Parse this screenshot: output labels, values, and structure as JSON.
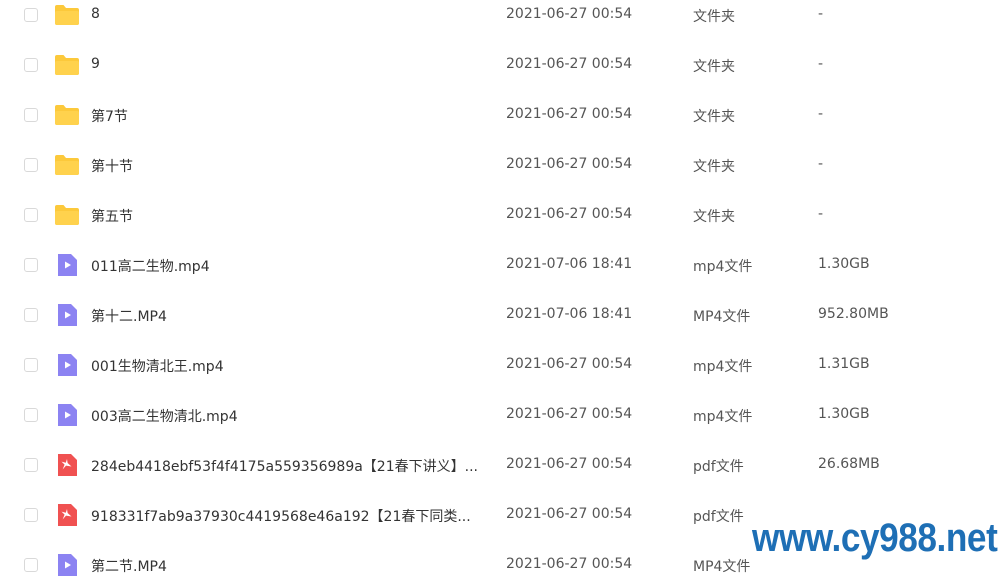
{
  "files": [
    {
      "name": "8",
      "date": "2021-06-27 00:54",
      "type": "文件夹",
      "size": "-",
      "icon": "folder-icon"
    },
    {
      "name": "9",
      "date": "2021-06-27 00:54",
      "type": "文件夹",
      "size": "-",
      "icon": "folder-icon"
    },
    {
      "name": "第7节",
      "date": "2021-06-27 00:54",
      "type": "文件夹",
      "size": "-",
      "icon": "folder-icon"
    },
    {
      "name": "第十节",
      "date": "2021-06-27 00:54",
      "type": "文件夹",
      "size": "-",
      "icon": "folder-icon"
    },
    {
      "name": "第五节",
      "date": "2021-06-27 00:54",
      "type": "文件夹",
      "size": "-",
      "icon": "folder-icon"
    },
    {
      "name": "011高二生物.mp4",
      "date": "2021-07-06 18:41",
      "type": "mp4文件",
      "size": "1.30GB",
      "icon": "video-icon"
    },
    {
      "name": "第十二.MP4",
      "date": "2021-07-06 18:41",
      "type": "MP4文件",
      "size": "952.80MB",
      "icon": "video-icon"
    },
    {
      "name": "001生物清北王.mp4",
      "date": "2021-06-27 00:54",
      "type": "mp4文件",
      "size": "1.31GB",
      "icon": "video-icon"
    },
    {
      "name": "003高二生物清北.mp4",
      "date": "2021-06-27 00:54",
      "type": "mp4文件",
      "size": "1.30GB",
      "icon": "video-icon"
    },
    {
      "name": "284eb4418ebf53f4f4175a559356989a【21春下讲义】...",
      "date": "2021-06-27 00:54",
      "type": "pdf文件",
      "size": "26.68MB",
      "icon": "pdf-icon"
    },
    {
      "name": "918331f7ab9a37930c4419568e46a192【21春下同类...",
      "date": "2021-06-27 00:54",
      "type": "pdf文件",
      "size": "",
      "icon": "pdf-icon"
    },
    {
      "name": "第二节.MP4",
      "date": "2021-06-27 00:54",
      "type": "MP4文件",
      "size": "",
      "icon": "video-icon"
    }
  ],
  "colors": {
    "folder": "#fcc93b",
    "video": "#8c83f2",
    "pdf": "#f05151",
    "watermark": "#1e6fb5"
  },
  "watermark": "www.cy988.net"
}
